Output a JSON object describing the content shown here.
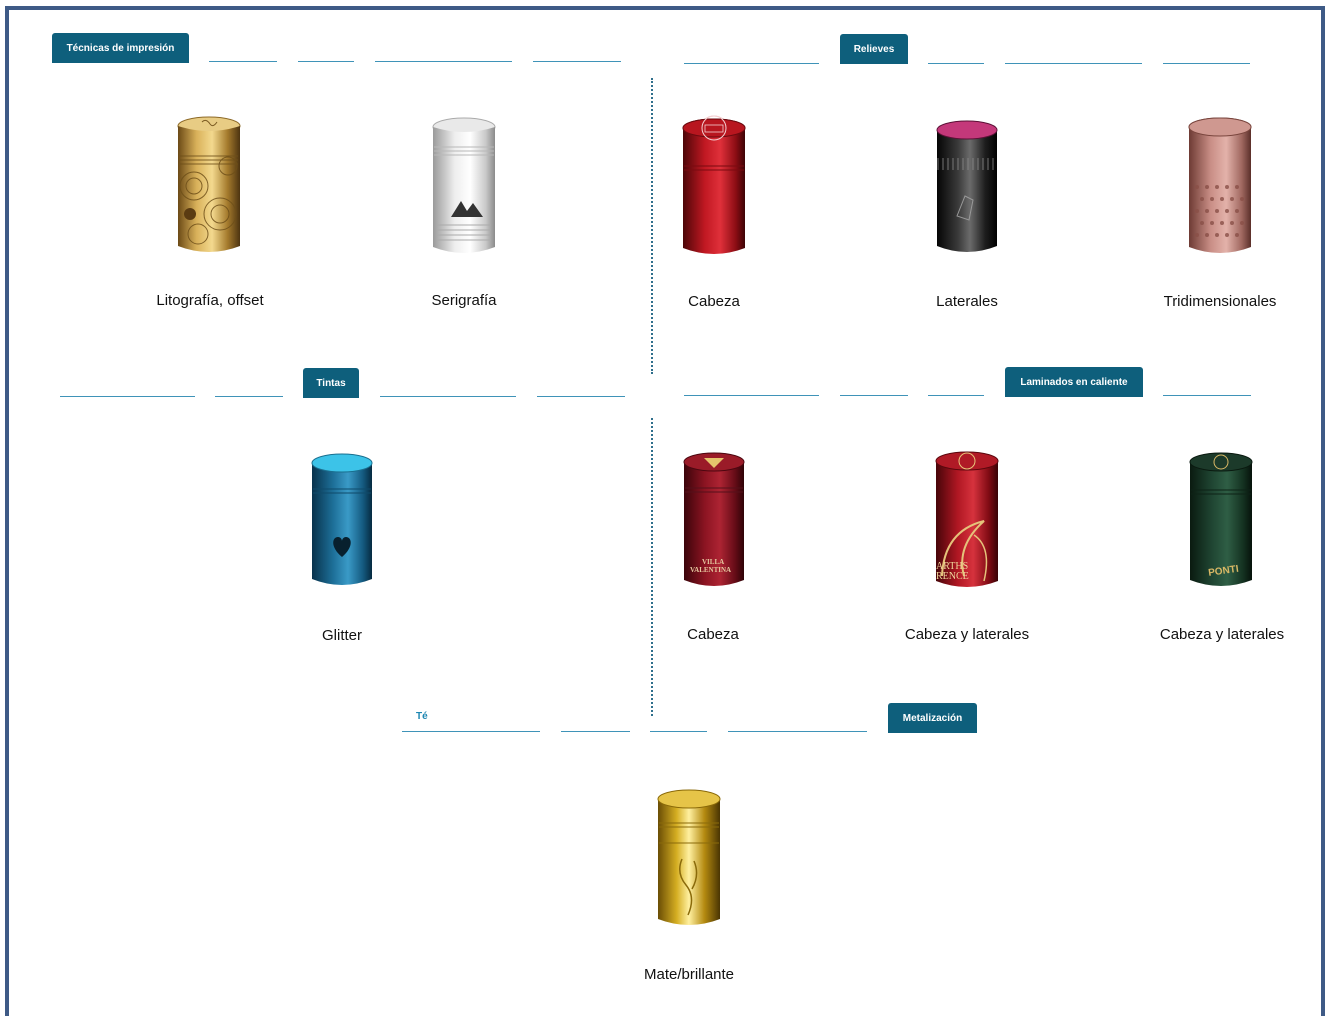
{
  "sections": {
    "tecnicas": {
      "tab": "Técnicas de impresión",
      "items": [
        {
          "label": "Litografía, offset",
          "icon": "gold-lithography-capsule-icon"
        },
        {
          "label": "Serigrafía",
          "icon": "white-screenprint-capsule-icon"
        }
      ]
    },
    "relieves": {
      "tab": "Relieves",
      "items": [
        {
          "label": "Cabeza",
          "icon": "red-embossed-head-capsule-icon"
        },
        {
          "label": "Laterales",
          "icon": "black-embossed-sides-capsule-icon"
        },
        {
          "label": "Tridimensionales",
          "icon": "pink-3d-capsule-icon"
        }
      ]
    },
    "tintas": {
      "tab": "Tintas",
      "items": [
        {
          "label": "Glitter",
          "icon": "blue-glitter-capsule-icon"
        }
      ]
    },
    "laminados": {
      "tab": "Laminados en caliente",
      "items": [
        {
          "label": "Cabeza",
          "icon": "burgundy-hotfoil-head-capsule-icon"
        },
        {
          "label": "Cabeza y laterales",
          "icon": "red-hotfoil-capsule-icon"
        },
        {
          "label": "Cabeza y laterales",
          "icon": "green-hotfoil-capsule-icon"
        }
      ]
    },
    "metalizacion": {
      "tab": "Metalización",
      "ghost_tab": "Té",
      "items": [
        {
          "label": "Mate/brillante",
          "icon": "gold-metallic-capsule-icon"
        }
      ]
    }
  },
  "colors": {
    "tab_bg": "#0e5f7c",
    "underline": "#3f93b8",
    "frame": "#3e5a86",
    "divider": "#2f6f8c"
  }
}
